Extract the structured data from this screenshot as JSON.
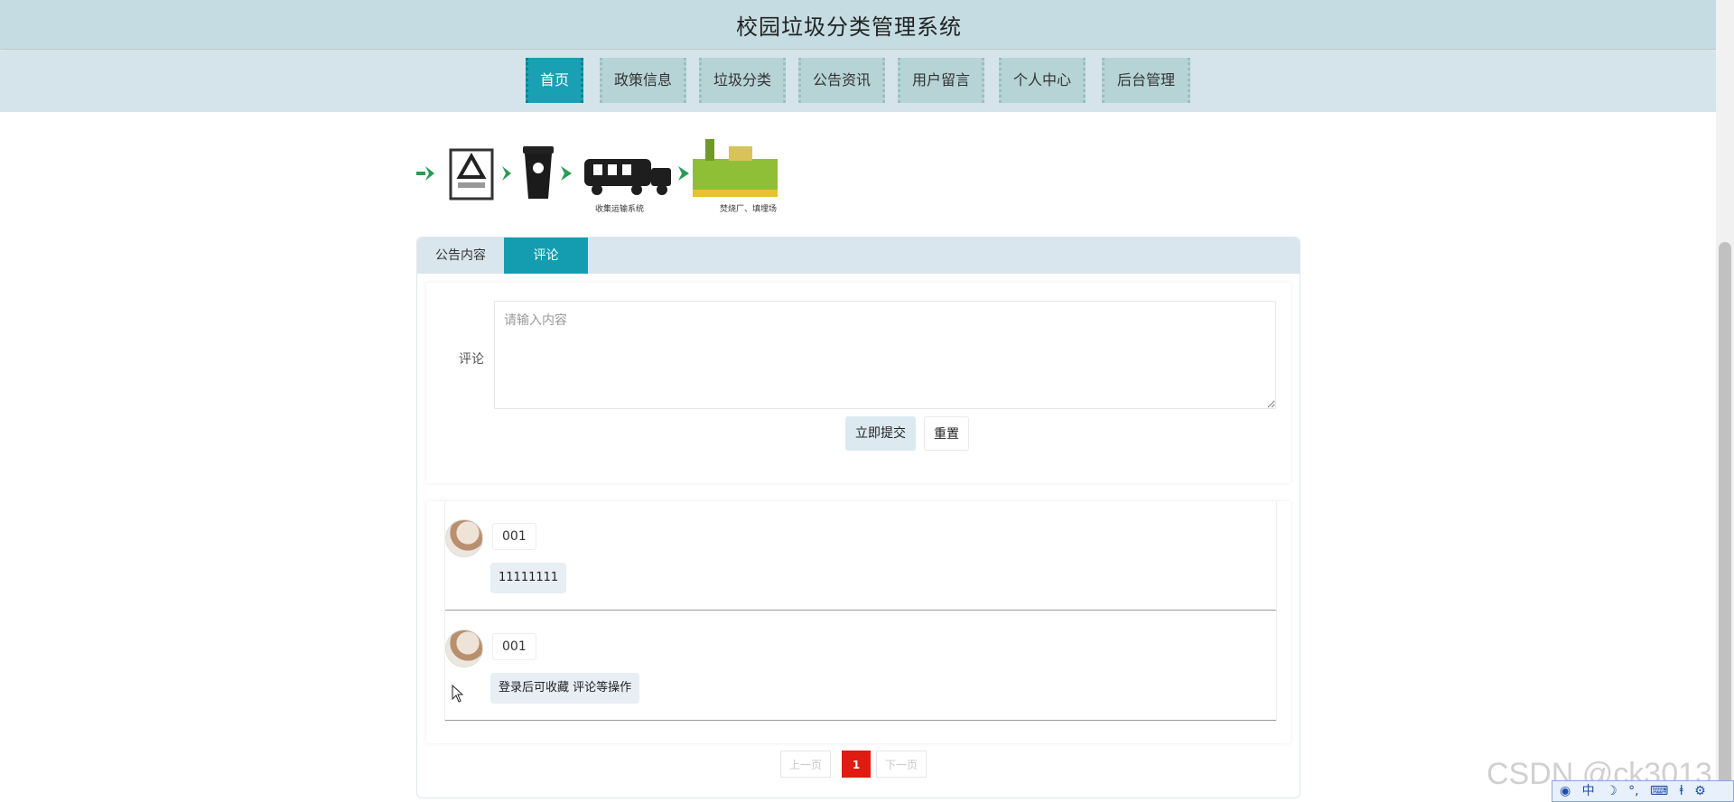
{
  "header": {
    "title": "校园垃圾分类管理系统"
  },
  "nav": {
    "items": [
      {
        "label": "首页",
        "active": true
      },
      {
        "label": "政策信息",
        "active": false
      },
      {
        "label": "垃圾分类",
        "active": false
      },
      {
        "label": "公告资讯",
        "active": false
      },
      {
        "label": "用户留言",
        "active": false
      },
      {
        "label": "个人中心",
        "active": false
      },
      {
        "label": "后台管理",
        "active": false
      }
    ]
  },
  "banner": {
    "captions": [
      "收集运输系统",
      "焚烧厂、填埋场"
    ],
    "icons": [
      "arrow-right-icon",
      "other-waste-sign-icon",
      "trash-bin-icon",
      "garbage-truck-icon",
      "incinerator-plant-icon"
    ]
  },
  "tabs": [
    {
      "label": "公告内容",
      "active": false
    },
    {
      "label": "评论",
      "active": true
    }
  ],
  "comment_form": {
    "label": "评论",
    "placeholder": "请输入内容",
    "value": "",
    "submit_label": "立即提交",
    "reset_label": "重置"
  },
  "comments": [
    {
      "username": "001",
      "content": "11111111"
    },
    {
      "username": "001",
      "content": "登录后可收藏 评论等操作"
    }
  ],
  "pagination": {
    "prev_label": "上一页",
    "current_page": "1",
    "next_label": "下一页"
  },
  "watermark": "CSDN @ck3013",
  "ime": {
    "items": [
      "中",
      "☽",
      "°,",
      "⌨",
      "ⱡ",
      "⚙"
    ]
  },
  "colors": {
    "header_bg": "#c5dde2",
    "nav_bg": "#d5e4ea",
    "nav_active": "#19a0b3",
    "tab_active": "#149db1",
    "page_current": "#e01b10"
  }
}
